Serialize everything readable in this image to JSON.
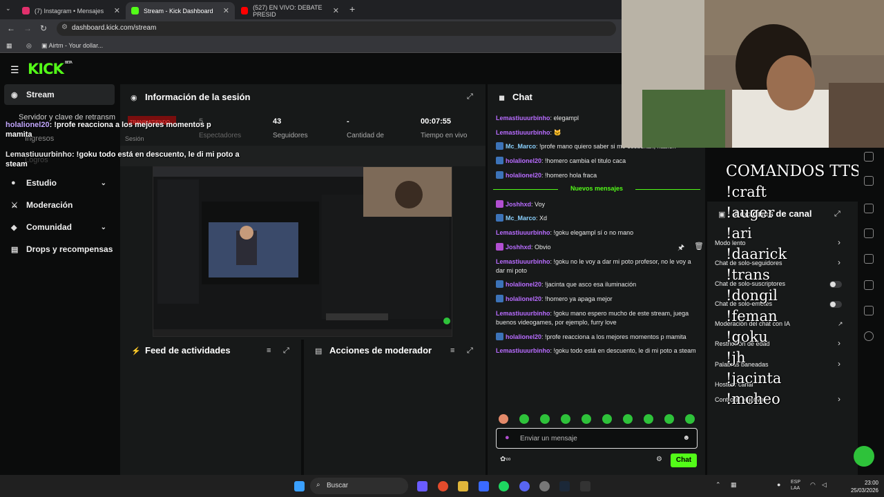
{
  "browser": {
    "tabs": [
      {
        "label": "(7) Instagram • Mensajes",
        "color": "#e1306c"
      },
      {
        "label": "Stream - Kick Dashboard",
        "color": "#53fc18"
      },
      {
        "label": "(527) EN VIVO: DEBATE PRESID",
        "color": "#ff0000"
      }
    ],
    "url": "dashboard.kick.com/stream",
    "bookmark": "Airtm - Your dollar..."
  },
  "app": {
    "logo": "KICK",
    "logo_sup": "BETA",
    "sidebar": [
      {
        "label": "Stream",
        "icon": "broadcast-icon"
      },
      {
        "label": "Estudio",
        "icon": "person-icon"
      },
      {
        "label": "Moderación",
        "icon": "sword-icon"
      },
      {
        "label": "Comunidad",
        "icon": "chat-icon"
      },
      {
        "label": "Drops y recompensas",
        "icon": "gift-icon"
      }
    ],
    "sidebar_ghost": [
      "Ingresos",
      "Logros",
      "Servidor y clave de retransm"
    ]
  },
  "session": {
    "title": "Información de la sesión",
    "ghost_badge": "TRANSMITIENDO",
    "ghost_label": "Sesión",
    "stats": [
      {
        "value": "5",
        "label": "Espectadores"
      },
      {
        "value": "43",
        "label": "Seguidores"
      },
      {
        "value": "-",
        "label": "Cantidad de"
      },
      {
        "value": "00:07:55",
        "label": "Tiempo en vivo"
      }
    ]
  },
  "overlay_chat": [
    {
      "user": "holalionel20",
      "text": " !profe reacciona a los mejores momentos p mamita"
    },
    {
      "user": "Lemastiuuurbinho",
      "text": " !goku todo está en descuento, le di mi poto a steam"
    }
  ],
  "panels": {
    "feed": "Feed de actividades",
    "mod_actions": "Acciones de moderador",
    "chat": "Chat",
    "channel_actions": "Acciones de canal"
  },
  "chat": {
    "new_messages": "Nuevos mensajes",
    "messages_before": [
      {
        "user": "Lemastiuuurbinho",
        "text": "elegampl",
        "badge": "",
        "color": "#b86cff"
      },
      {
        "user": "Lemastiuuurbinho",
        "text": "🐱",
        "badge": "",
        "color": "#b86cff"
      },
      {
        "user": "Mc_Marco",
        "text": "!profe mano quiero saber si me escuchan, hablen",
        "badge": "blue",
        "color": "#8ad1ff"
      },
      {
        "user": "holalionel20",
        "text": "!homero cambia el titulo caca",
        "badge": "blue",
        "color": "#b86cff"
      },
      {
        "user": "holalionel20",
        "text": "!homero hola fraca",
        "badge": "blue",
        "color": "#b86cff"
      }
    ],
    "messages_after": [
      {
        "user": "Joshhxd",
        "text": "Voy",
        "badge": "pink",
        "color": "#b86cff"
      },
      {
        "user": "Mc_Marco",
        "text": "Xd",
        "badge": "blue",
        "color": "#8ad1ff"
      },
      {
        "user": "Lemastiuuurbinho",
        "text": "!goku elegampl sí o no mano",
        "badge": "",
        "color": "#b86cff"
      },
      {
        "user": "Joshhxd",
        "text": "Obvio",
        "badge": "pink",
        "color": "#b86cff"
      },
      {
        "user": "Lemastiuuurbinho",
        "text": "!goku no le voy a dar mi poto profesor, no le voy a dar mi poto",
        "badge": "",
        "color": "#b86cff"
      },
      {
        "user": "holalionel20",
        "text": "!jacinta que asco esa iluminación",
        "badge": "blue",
        "color": "#b86cff"
      },
      {
        "user": "holalionel20",
        "text": "!homero ya apaga mejor",
        "badge": "blue",
        "color": "#b86cff"
      },
      {
        "user": "Lemastiuuurbinho",
        "text": "!goku mano espero mucho de este stream, juega buenos videogames, por ejemplo, furry love",
        "badge": "",
        "color": "#b86cff"
      },
      {
        "user": "holalionel20",
        "text": "!profe reacciona a los mejores momentos p mamita",
        "badge": "blue",
        "color": "#b86cff"
      },
      {
        "user": "Lemastiuuurbinho",
        "text": "!goku todo está en descuento, le di mi poto a steam",
        "badge": "",
        "color": "#b86cff"
      }
    ],
    "input_placeholder": "Enviar un mensaje",
    "send_label": "Chat"
  },
  "channel_controls": [
    {
      "label": "Modo lento",
      "control": "chevron"
    },
    {
      "label": "Chat de solo-seguidores",
      "control": "chevron"
    },
    {
      "label": "Chat de solo-suscriptores",
      "control": "toggle"
    },
    {
      "label": "Chat de solo-emotes",
      "control": "toggle"
    },
    {
      "label": "Moderación del chat con IA",
      "control": "external"
    },
    {
      "label": "Restricción de edad",
      "control": "chevron"
    },
    {
      "label": "Palabras baneadas",
      "control": "chevron"
    },
    {
      "label": "Hostear canal",
      "control": "none"
    },
    {
      "label": "Controlar objetivos",
      "control": "chevron"
    }
  ],
  "tts_overlay": {
    "title": "COMANDOS TTS:",
    "commands": [
      "!craft",
      "!auger",
      "!ari",
      "!daarick",
      "!trans",
      "!dongil",
      "!feman",
      "!goku",
      "!jh",
      "!jacinta",
      "!mcheo"
    ]
  },
  "taskbar": {
    "search": "Buscar",
    "lang": "ESP",
    "lang2": "LAA",
    "time": "23:00",
    "date": "25/03/2026"
  }
}
